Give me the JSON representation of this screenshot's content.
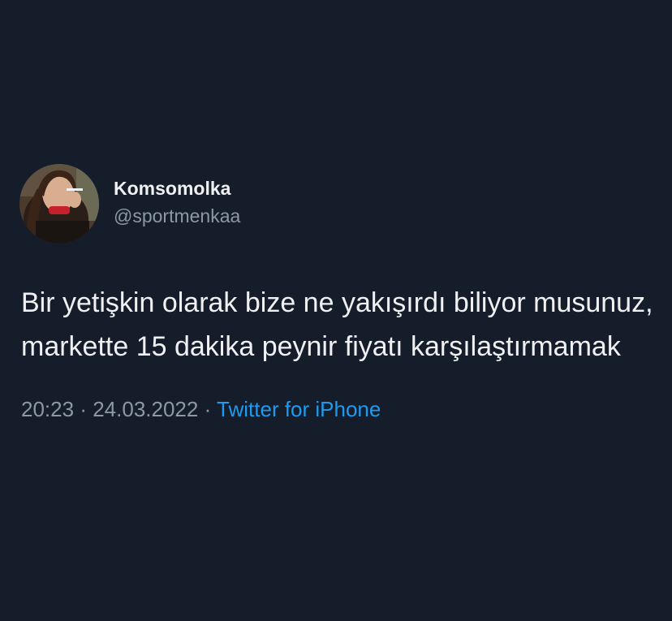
{
  "tweet": {
    "author": {
      "display_name": "Komsomolka",
      "handle": "@sportmenkaa",
      "avatar_icon": "profile-photo"
    },
    "text": "Bir yetişkin olarak bize ne yakışırdı biliyor musunuz, markette 15 dakika peynir fiyatı karşılaştırmamak",
    "time": "20:23",
    "separator": "·",
    "date": "24.03.2022",
    "source": "Twitter for iPhone"
  },
  "colors": {
    "background": "#151d2a",
    "primary_text": "#eef0f1",
    "secondary_text": "#8b98a5",
    "link": "#1d9bf0"
  }
}
